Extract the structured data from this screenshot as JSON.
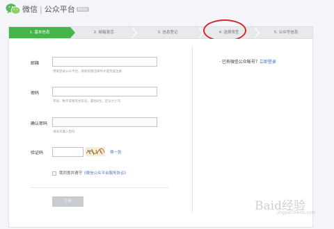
{
  "header": {
    "brand_main": "微信",
    "brand_sep": "|",
    "brand_sub": "公众平台",
    "beta": "Beta"
  },
  "steps": [
    {
      "label": "1. 基本信息",
      "active": true
    },
    {
      "label": "2. 邮箱激活",
      "active": false
    },
    {
      "label": "3. 信息登记",
      "active": false
    },
    {
      "label": "4. 选择类型",
      "active": false
    },
    {
      "label": "5. 公众号信息",
      "active": false
    }
  ],
  "form": {
    "email": {
      "label": "邮箱",
      "value": "",
      "hint": "用来登录公众平台，接收到激活邮件才能完成注册"
    },
    "password": {
      "label": "密码",
      "value": "",
      "hint": "字母、数字或者英文符号，最短8位，区分大小写"
    },
    "confirm": {
      "label": "确认密码",
      "value": "",
      "hint": "请再次输入密码"
    },
    "captcha": {
      "label": "验证码",
      "value": "",
      "refresh": "换一张"
    },
    "agree_text": "我同意并遵守",
    "agree_link": "《微信公众平台服务协议》",
    "submit": "注册"
  },
  "side": {
    "prefix": "· 已有微信公众帐号？",
    "link": "立即登录"
  },
  "watermark": {
    "text": "Baid经验",
    "sub": "jingyan.baidu.com"
  },
  "colors": {
    "active_step": "#44b549",
    "link": "#4a79c2",
    "highlight_circle": "#d5262a"
  }
}
